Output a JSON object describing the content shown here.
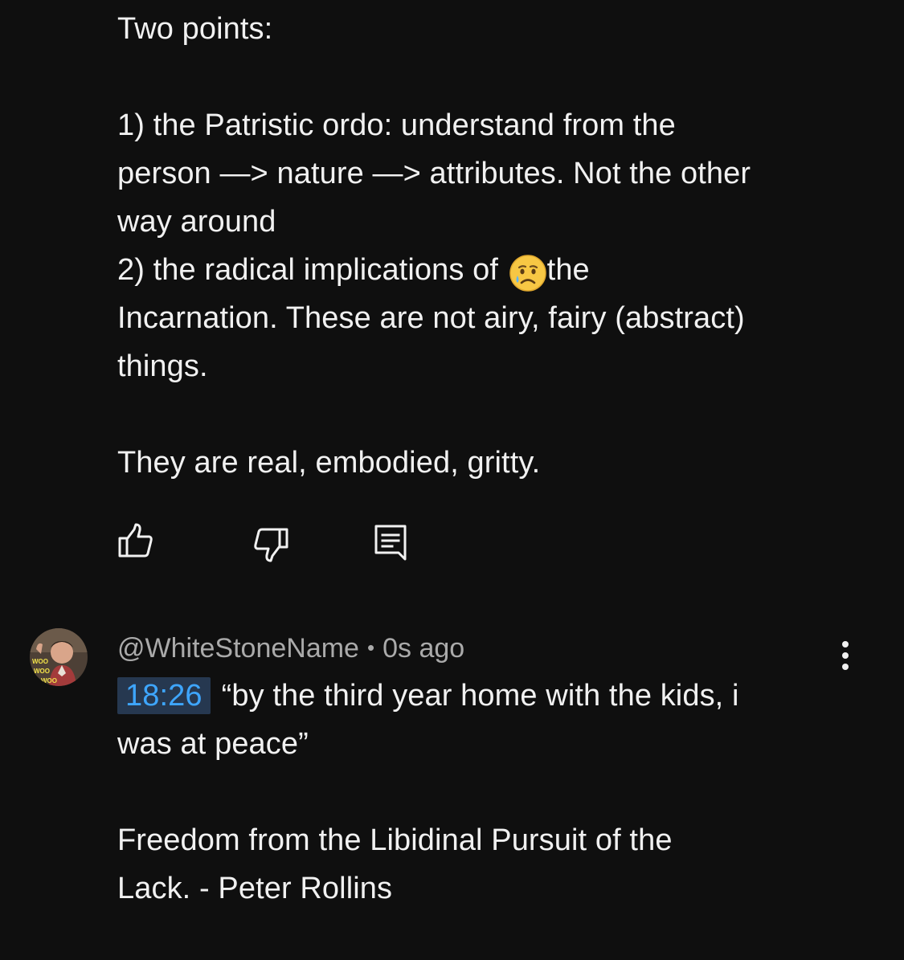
{
  "comment1": {
    "lines": [
      "Two points:",
      "",
      "1) the Patristic ordo: understand from the",
      "person —> nature —> attributes. Not the other",
      "way around",
      "2) the radical implications of ",
      "Incarnation. These are not airy, fairy (abstract)",
      "things.",
      "",
      "They are real, embodied, gritty."
    ],
    "line6_after_emoji": "the",
    "emoji": "crying-face-emoji"
  },
  "actions": {
    "like_icon": "thumbs-up-icon",
    "dislike_icon": "thumbs-down-icon",
    "reply_icon": "reply-comment-icon"
  },
  "comment2": {
    "author": "@WhiteStoneName",
    "separator": "•",
    "time_ago": "0s ago",
    "timestamp_link": "18:26",
    "line1_rest": "“by the third year home with the kids, i",
    "line2": "was at peace”",
    "line4": "Freedom from the Libidinal Pursuit of the",
    "line5": "Lack. - Peter Rollins",
    "avatar_text": "WOO",
    "more_icon": "more-vertical-icon"
  },
  "colors": {
    "background": "#0f0f0f",
    "text": "#f1f1f1",
    "secondary_text": "#aaaaaa",
    "link": "#3ea6ff",
    "timestamp_bg": "#263850"
  }
}
